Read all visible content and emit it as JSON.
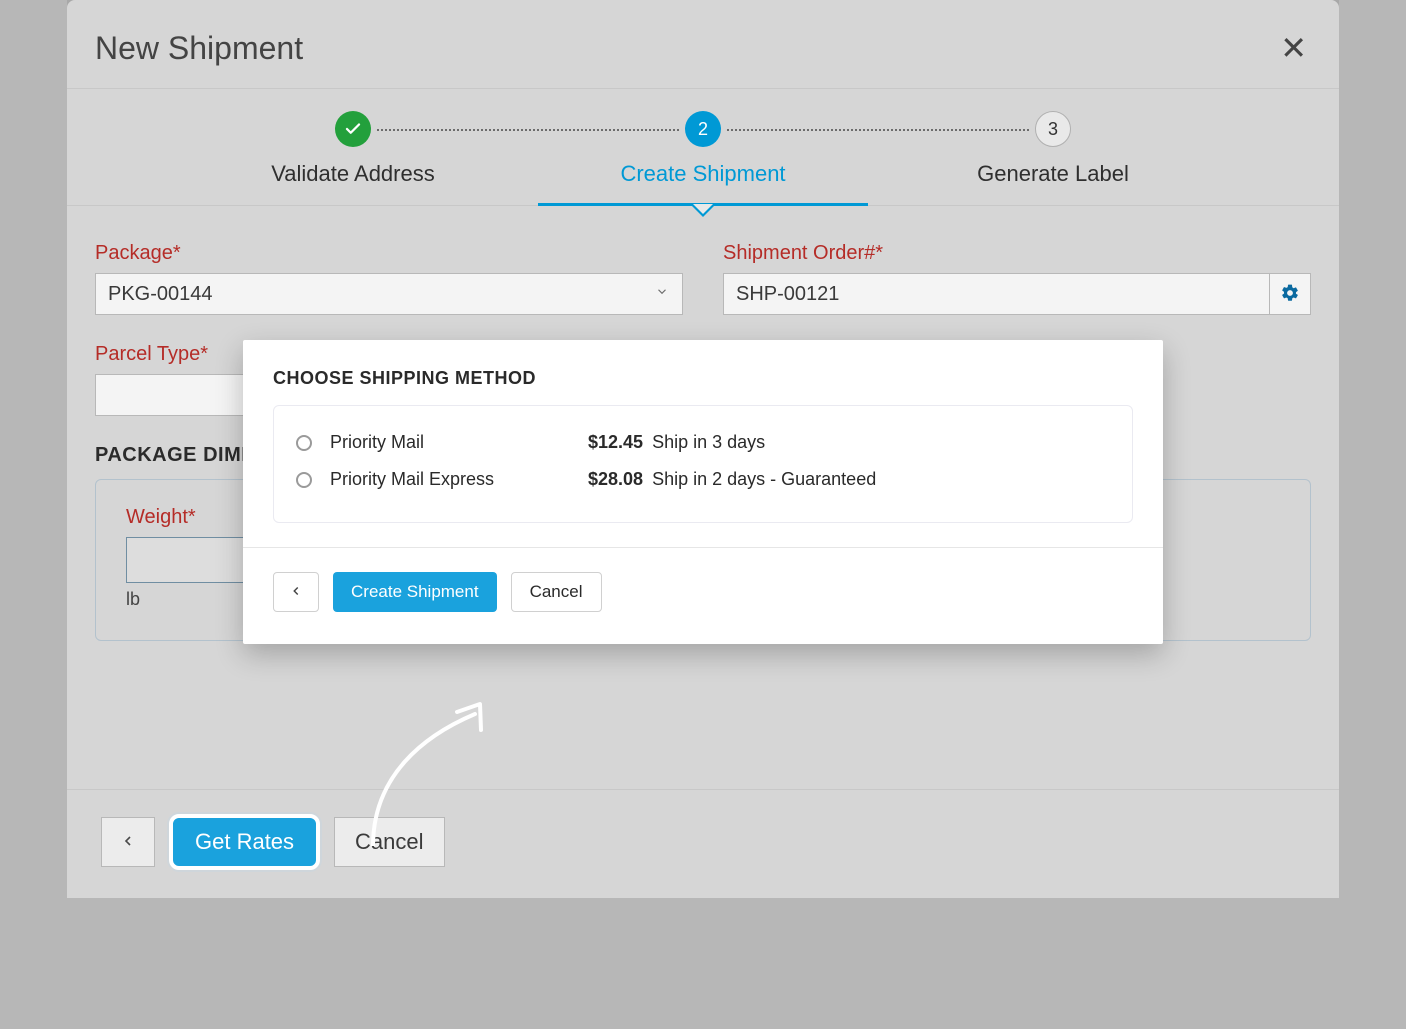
{
  "window": {
    "title": "New Shipment",
    "close_label": "Close"
  },
  "stepper": {
    "steps": [
      {
        "label": "Validate Address",
        "state": "done"
      },
      {
        "label": "Create Shipment",
        "state": "active",
        "num": "2"
      },
      {
        "label": "Generate Label",
        "state": "pending",
        "num": "3"
      }
    ]
  },
  "fields": {
    "package_label": "Package*",
    "package_value": "PKG-00144",
    "shipment_order_label": "Shipment Order#*",
    "shipment_order_value": "SHP-00121",
    "parcel_type_label": "Parcel Type*",
    "parcel_type_value": "",
    "dimensions_heading": "PACKAGE DIMENSIONS",
    "weight_label": "Weight*",
    "weight_value": "",
    "weight_unit": "lb"
  },
  "actions": {
    "back_label": "Back",
    "get_rates": "Get Rates",
    "cancel": "Cancel"
  },
  "modal": {
    "title": "CHOOSE SHIPPING METHOD",
    "methods": [
      {
        "name": "Priority Mail",
        "price": "$12.45",
        "detail": "Ship in 3 days"
      },
      {
        "name": "Priority Mail Express",
        "price": "$28.08",
        "detail": "Ship in 2 days - Guaranteed"
      }
    ],
    "actions": {
      "back_label": "Back",
      "create": "Create Shipment",
      "cancel": "Cancel"
    }
  },
  "colors": {
    "accent": "#1aa2dd",
    "success": "#23a03c",
    "danger": "#c5302b"
  }
}
